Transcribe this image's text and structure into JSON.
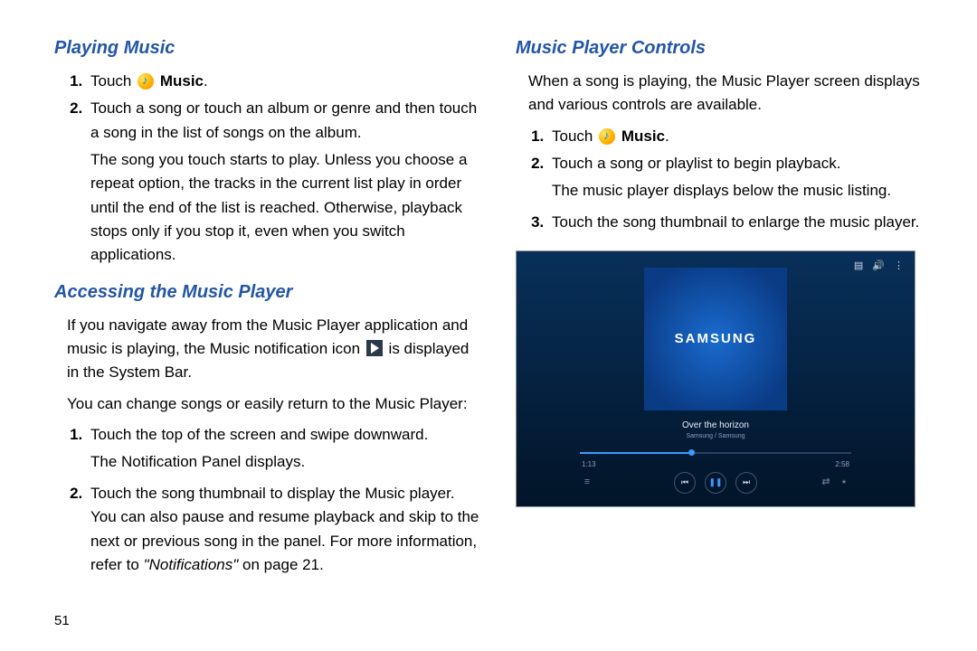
{
  "pageNumber": "51",
  "leftColumn": {
    "heading1": "Playing Music",
    "step1_prefix": "Touch ",
    "step1_bold": "Music",
    "step1_suffix": ".",
    "step2": "Touch a song or touch an album or genre and then touch a song in the list of songs on the album.",
    "step2_cont": "The song you touch starts to play. Unless you choose a repeat option, the tracks in the current list play in order until the end of the list is reached. Otherwise, playback stops only if you stop it, even when you switch applications.",
    "heading2": "Accessing the Music Player",
    "para1_a": "If you navigate away from the Music Player application and music is playing, the Music notification icon ",
    "para1_b": " is displayed in the System Bar.",
    "para2": "You can change songs or easily return to the Music Player:",
    "accStep1": "Touch the top of the screen and swipe downward.",
    "accStep1_cont": "The Notification Panel displays.",
    "accStep2_a": "Touch the song thumbnail to display the Music player. You can also pause and resume playback and skip to the next or previous song in the panel. For more information, refer to ",
    "accStep2_ref": "\"Notifications\"",
    "accStep2_b": " on page 21."
  },
  "rightColumn": {
    "heading1": "Music Player Controls",
    "para1": "When a song is playing, the Music Player screen displays and various controls are available.",
    "step1_prefix": "Touch ",
    "step1_bold": "Music",
    "step1_suffix": ".",
    "step2": "Touch a song or playlist to begin playback.",
    "step2_cont": "The music player displays below the music listing.",
    "step3": "Touch the song thumbnail to enlarge the music player."
  },
  "player": {
    "logo": "SAMSUNG",
    "trackTitle": "Over the horizon",
    "trackArtist": "Samsung / Samsung",
    "timeElapsed": "1:13",
    "timeTotal": "2:58"
  }
}
